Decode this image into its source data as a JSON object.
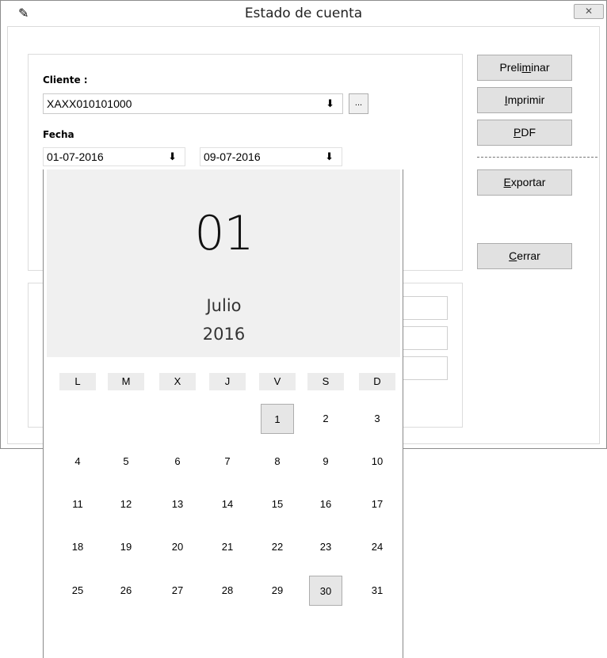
{
  "window": {
    "title": "Estado de cuenta",
    "close_glyph": "✕",
    "icon_glyph": "✎"
  },
  "form": {
    "cliente_label": "Cliente :",
    "cliente_value": "XAXX010101000",
    "dots_label": "...",
    "fecha_label": "Fecha",
    "fecha_desde": "01-07-2016",
    "fecha_hasta": "09-07-2016",
    "arrow_glyph": "⬇"
  },
  "buttons": {
    "preliminar": {
      "pre": "Preli",
      "acc": "m",
      "post": "inar"
    },
    "imprimir": {
      "pre": "",
      "acc": "I",
      "post": "mprimir"
    },
    "pdf": {
      "pre": "",
      "acc": "P",
      "post": "DF"
    },
    "exportar": {
      "pre": "",
      "acc": "E",
      "post": "xportar"
    },
    "cerrar": {
      "pre": "",
      "acc": "C",
      "post": "errar"
    }
  },
  "calendar": {
    "day": "01",
    "month": "Julio",
    "year": "2016",
    "weekdays": [
      "L",
      "M",
      "X",
      "J",
      "V",
      "S",
      "D"
    ],
    "weeks": [
      [
        "",
        "",
        "",
        "",
        "1",
        "2",
        "3"
      ],
      [
        "4",
        "5",
        "6",
        "7",
        "8",
        "9",
        "10"
      ],
      [
        "11",
        "12",
        "13",
        "14",
        "15",
        "16",
        "17"
      ],
      [
        "18",
        "19",
        "20",
        "21",
        "22",
        "23",
        "24"
      ],
      [
        "25",
        "26",
        "27",
        "28",
        "29",
        "30",
        "31"
      ]
    ],
    "highlighted": [
      "1",
      "30"
    ]
  }
}
